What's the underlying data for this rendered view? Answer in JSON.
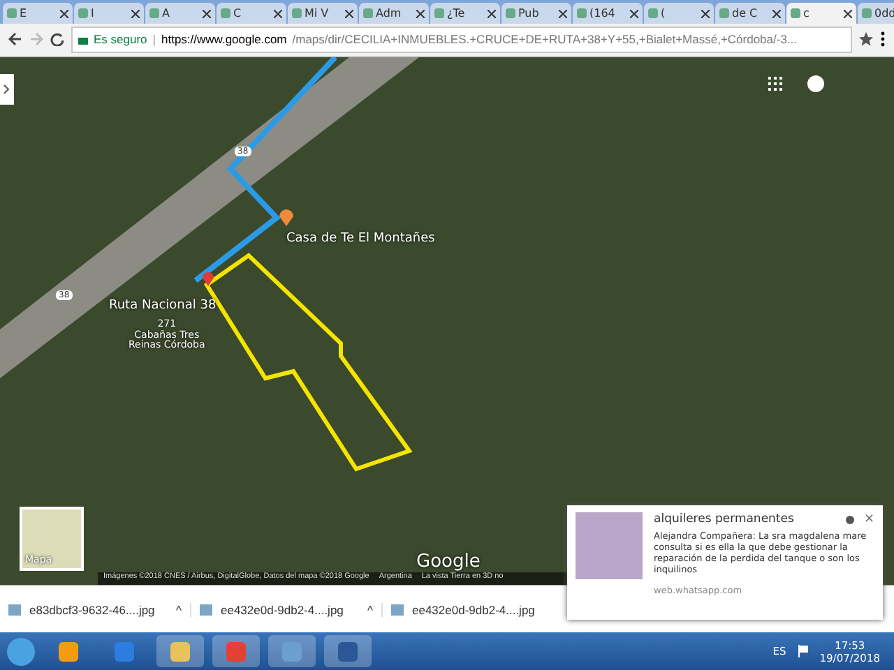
{
  "tabs": [
    {
      "label": "E",
      "selected": false
    },
    {
      "label": "I",
      "selected": false
    },
    {
      "label": "A",
      "selected": false
    },
    {
      "label": "C",
      "selected": false
    },
    {
      "label": "Mi V",
      "selected": false
    },
    {
      "label": "Adm",
      "selected": false
    },
    {
      "label": "¿Te",
      "selected": false
    },
    {
      "label": "Pub",
      "selected": false
    },
    {
      "label": "(164",
      "selected": false
    },
    {
      "label": "(",
      "selected": false
    },
    {
      "label": "de C",
      "selected": false
    },
    {
      "label": "c",
      "selected": true
    },
    {
      "label": "0dd",
      "selected": false
    }
  ],
  "address_bar": {
    "security": "Es seguro",
    "separator": "|",
    "url_host": "https://www.google.com",
    "url_path": "/maps/dir/CECILIA+INMUEBLES.+CRUCE+DE+RUTA+38+Y+55,+Bialet+Massé,+Córdoba/-3..."
  },
  "map": {
    "labels": [
      {
        "kind": "road",
        "text": "Ruta Nacional 38"
      },
      {
        "kind": "place",
        "text": "Casa de Te El Montañes"
      },
      {
        "kind": "business",
        "text": "271\nCabañas Tres\nReinas Córdoba"
      }
    ],
    "shields": [
      "38",
      "38"
    ],
    "layer_button": "Mapa",
    "logo": "Google",
    "attribution": [
      "Imágenes ©2018 CNES / Airbus, DigitalGlobe, Datos del mapa ©2018 Google",
      "Argentina",
      "La vista Tierra en 3D no"
    ]
  },
  "notification": {
    "title": "alquileres permanentes",
    "body": "Alejandra Compañera: La sra magdalena mare consulta si es ella la que debe gestionar la reparación de la perdida del tanque o son los inquilinos",
    "source": "web.whatsapp.com",
    "close": "×"
  },
  "downloads": [
    {
      "name": "e83dbcf3-9632-46....jpg",
      "caret": "^"
    },
    {
      "name": "ee432e0d-9db2-4....jpg",
      "caret": "^"
    },
    {
      "name": "ee432e0d-9db2-4....jpg"
    }
  ],
  "taskbar": {
    "language": "ES",
    "time": "17:53",
    "date": "19/07/2018"
  }
}
